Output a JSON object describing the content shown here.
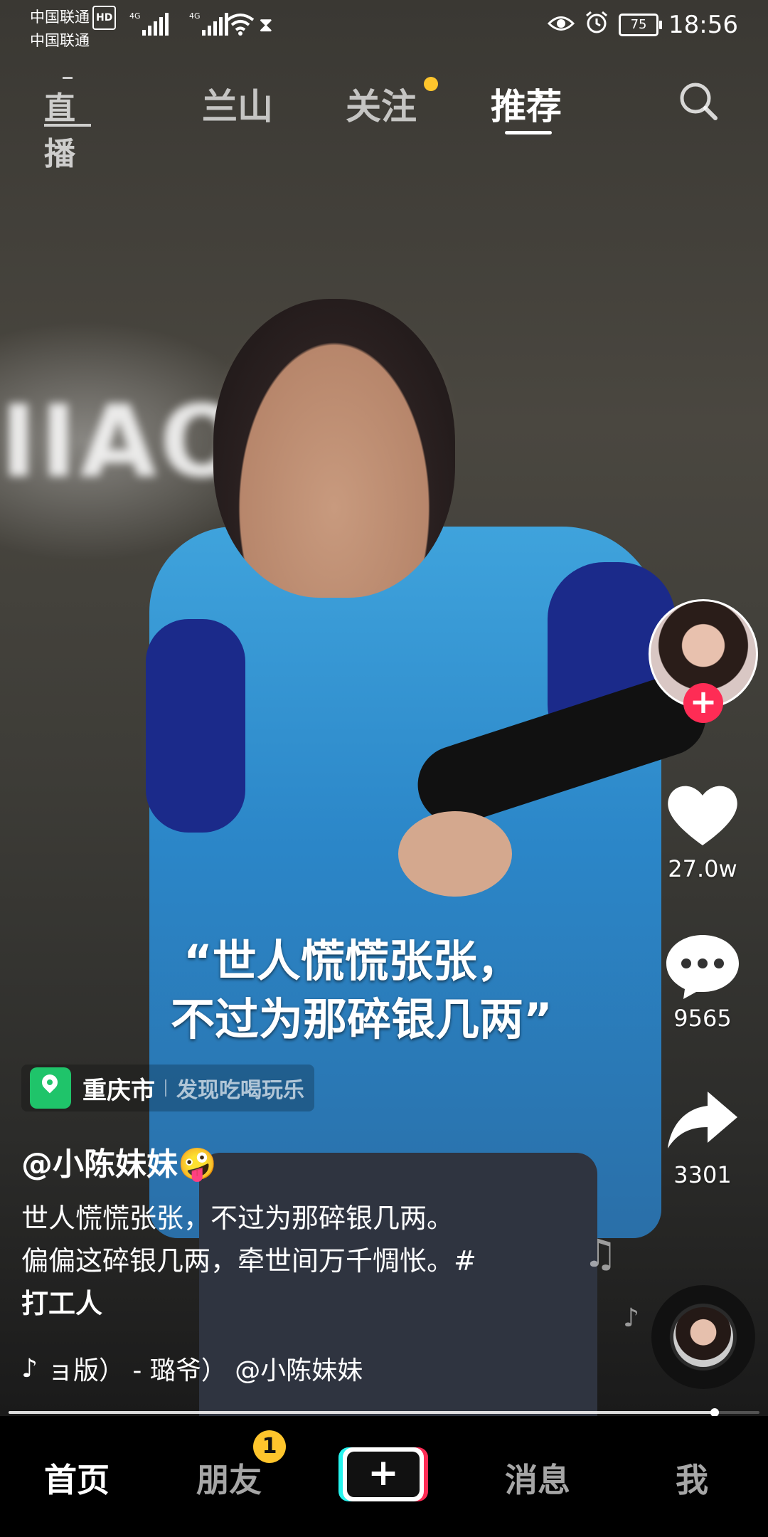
{
  "status_bar": {
    "carrier1": "中国联通",
    "carrier2": "中国联通",
    "hd": "HD",
    "net1": "4G",
    "net2": "4G",
    "battery": "75",
    "time": "18:56",
    "icons": [
      "signal-icon",
      "wifi-icon",
      "hourglass-icon",
      "eye-icon",
      "alarm-icon",
      "battery-icon"
    ]
  },
  "top_nav": {
    "live_label": "直播",
    "tabs": [
      {
        "label": "兰山"
      },
      {
        "label": "关注"
      },
      {
        "label": "推荐"
      }
    ],
    "active_tab": "推荐"
  },
  "video": {
    "glow_text": "IIAO",
    "quote_line1": "“世人慌慌张张，",
    "quote_line2": "不过为那碎银几两”"
  },
  "actions": {
    "likes": "27.0w",
    "comments": "9565",
    "shares": "3301"
  },
  "location": {
    "city": "重庆市",
    "tag": "发现吃喝玩乐"
  },
  "post": {
    "author": "@小陈妹妹🤪",
    "desc_line1": "世人慌慌张张，不过为那碎银几两。",
    "desc_line2": "偏偏这碎银几两，牵世间万千惆怅。#",
    "hashtag": "打工人",
    "music": "ョ版） - 璐爷）    @小陈妹妹"
  },
  "progress": 0.94,
  "bottom_nav": {
    "home": "首页",
    "friends": "朋友",
    "friends_badge": "1",
    "create": "+",
    "messages": "消息",
    "me": "我"
  }
}
